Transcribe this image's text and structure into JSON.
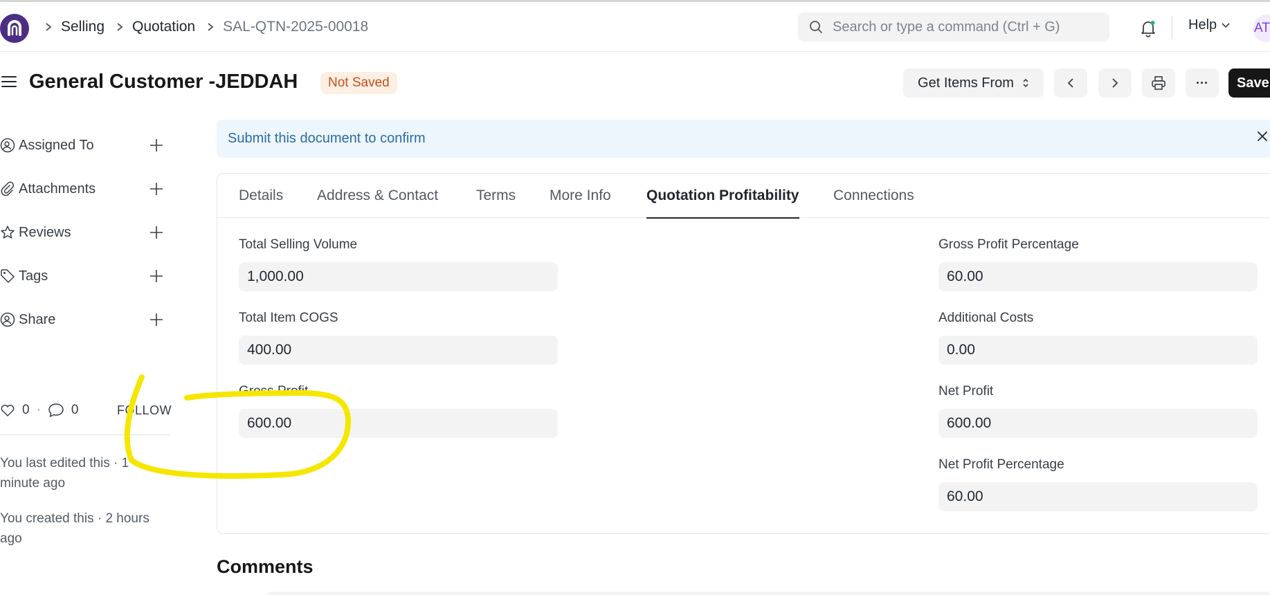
{
  "breadcrumbs": [
    "Selling",
    "Quotation",
    "SAL-QTN-2025-00018"
  ],
  "search": {
    "placeholder": "Search or type a command (Ctrl + G)"
  },
  "navbar": {
    "help_label": "Help",
    "avatar_initials": "AT"
  },
  "page": {
    "title": "General Customer -JEDDAH",
    "status": "Not Saved"
  },
  "actions": {
    "get_items_label": "Get Items From",
    "more_label": "···",
    "save_label": "Save"
  },
  "sidebar": {
    "items": [
      {
        "label": "Assigned To",
        "icon": "assign-user-icon"
      },
      {
        "label": "Attachments",
        "icon": "paperclip-icon"
      },
      {
        "label": "Reviews",
        "icon": "star-icon"
      },
      {
        "label": "Tags",
        "icon": "tag-icon"
      },
      {
        "label": "Share",
        "icon": "share-user-icon"
      }
    ],
    "likes": "0",
    "comments_count": "0",
    "follow_label": "FOLLOW",
    "activity": [
      "You last edited this · 1 minute ago",
      "You created this · 2 hours ago"
    ]
  },
  "banner": {
    "text": "Submit this document to confirm"
  },
  "tabs": [
    "Details",
    "Address & Contact",
    "Terms",
    "More Info",
    "Quotation Profitability",
    "Connections"
  ],
  "active_tab": "Quotation Profitability",
  "fields": {
    "total_selling_volume": {
      "label": "Total Selling Volume",
      "value": "1,000.00"
    },
    "total_item_cogs": {
      "label": "Total Item COGS",
      "value": "400.00"
    },
    "gross_profit": {
      "label": "Gross Profit",
      "value": "600.00"
    },
    "gross_profit_percentage": {
      "label": "Gross Profit Percentage",
      "value": "60.00"
    },
    "additional_costs": {
      "label": "Additional Costs",
      "value": "0.00"
    },
    "net_profit": {
      "label": "Net Profit",
      "value": "600.00"
    },
    "net_profit_percentage": {
      "label": "Net Profit Percentage",
      "value": "60.00"
    }
  },
  "comments": {
    "heading": "Comments"
  },
  "colors": {
    "accent": "#4b2e83",
    "status": "#c4501b",
    "banner_text": "#2b6ca3",
    "annotation": "#f5e600"
  }
}
